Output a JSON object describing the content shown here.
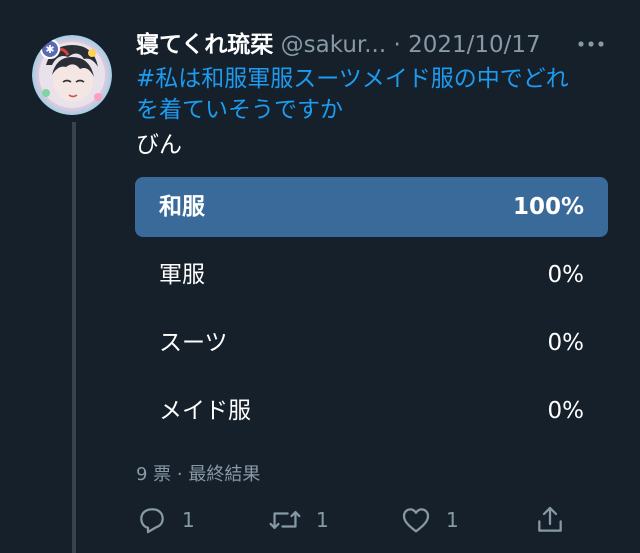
{
  "tweet": {
    "display_name": "寝てくれ琉栞",
    "handle": "@sakur...",
    "separator": "·",
    "date": "2021/10/17",
    "hashtag_line1": "#私は和服軍服スーツメイド服の中でどれ",
    "hashtag_line2": "を着ていそうですか",
    "text": "びん"
  },
  "poll": {
    "options": [
      {
        "label": "和服",
        "percent": "100%",
        "value": 100,
        "winner": true
      },
      {
        "label": "軍服",
        "percent": "0%",
        "value": 0,
        "winner": false
      },
      {
        "label": "スーツ",
        "percent": "0%",
        "value": 0,
        "winner": false
      },
      {
        "label": "メイド服",
        "percent": "0%",
        "value": 0,
        "winner": false
      }
    ],
    "meta": "9 票 · 最終結果"
  },
  "actions": {
    "reply": {
      "icon": "reply-icon",
      "count": "1"
    },
    "retweet": {
      "icon": "retweet-icon",
      "count": "1"
    },
    "like": {
      "icon": "heart-icon",
      "count": "1"
    },
    "share": {
      "icon": "share-icon"
    }
  },
  "colors": {
    "background": "#15202b",
    "accent": "#1d9bf0",
    "winner_bar": "#3a6a9a",
    "muted_text": "#8899a6",
    "thread_line": "#38444d"
  }
}
